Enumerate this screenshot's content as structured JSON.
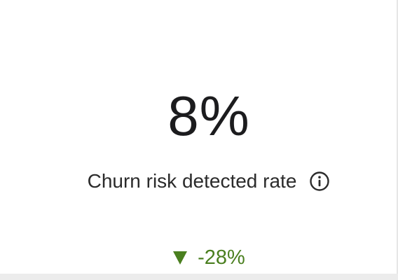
{
  "metric": {
    "value": "8%",
    "label": "Churn risk detected rate",
    "info_icon": "info-circle-icon"
  },
  "change": {
    "direction": "down",
    "arrow_icon": "triangle-down-icon",
    "value": "-28%",
    "color": "#4a7f1f"
  }
}
